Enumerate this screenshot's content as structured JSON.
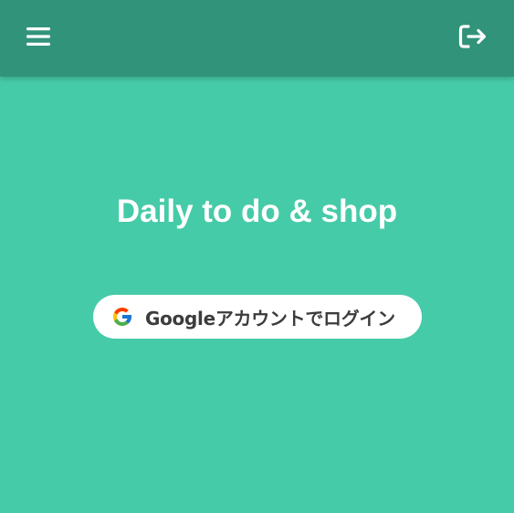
{
  "header": {
    "menu_icon": "hamburger-menu-icon",
    "logout_icon": "logout-icon",
    "bar_color": "#31937a"
  },
  "main": {
    "title": "Daily to do & shop",
    "background_color": "#46cba8",
    "login_button": {
      "label": "Googleアカウントでログイン",
      "icon": "google-logo-icon"
    }
  }
}
